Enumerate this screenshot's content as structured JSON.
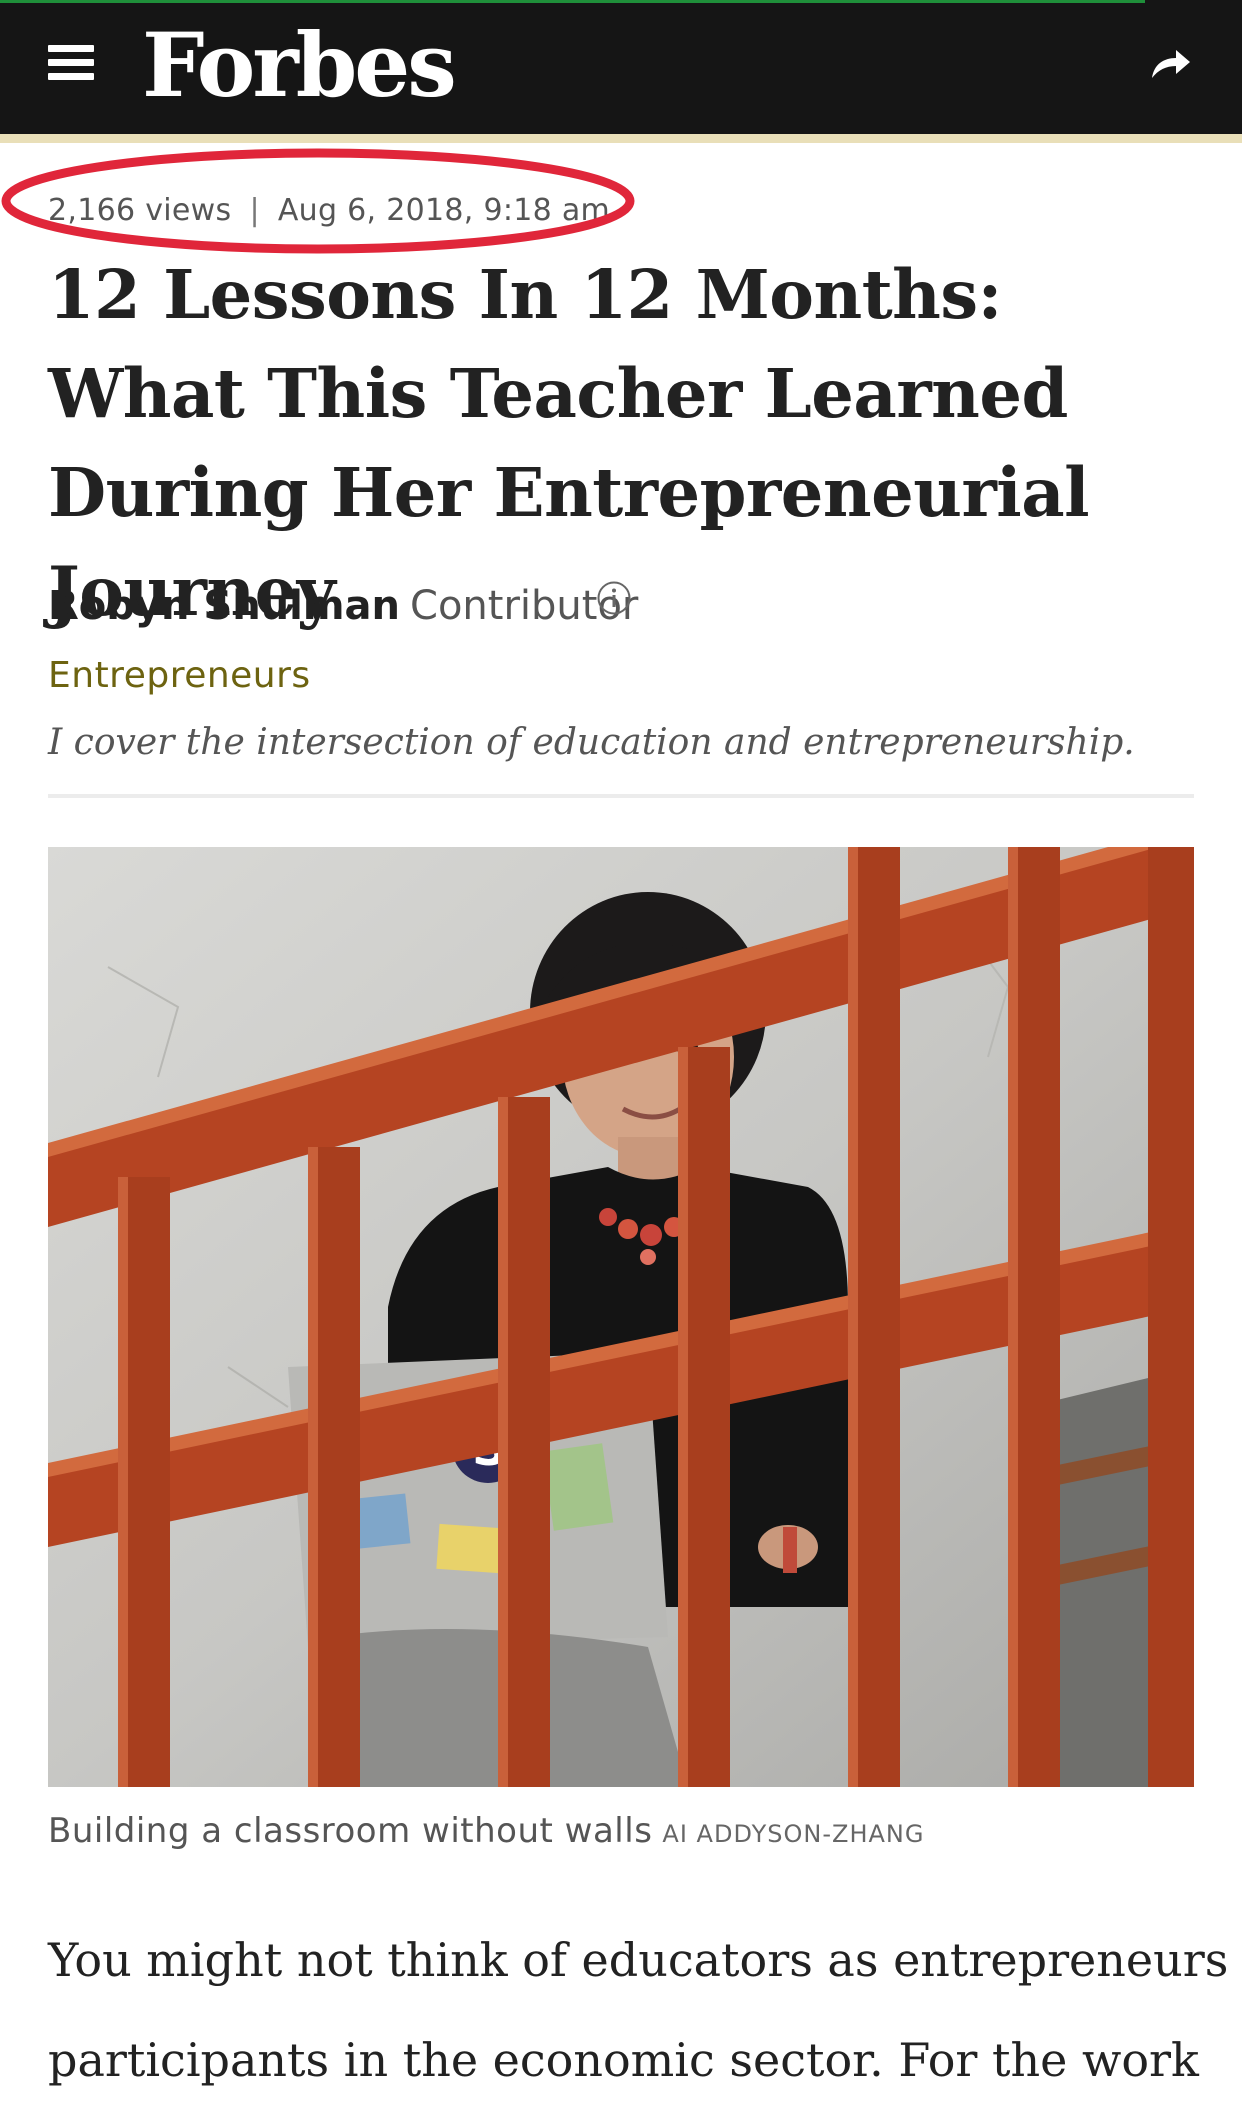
{
  "header": {
    "logo": "Forbes",
    "menu_icon": "hamburger-menu-icon",
    "share_icon": "share-arrow-icon"
  },
  "article": {
    "views": "2,166 views",
    "separator": "|",
    "date": "Aug 6, 2018, 9:18 am",
    "title": "12 Lessons In 12 Months: What This Teacher Learned During Her Entrepreneurial Journey",
    "author": "Robyn Shulman",
    "author_role": "Contributor",
    "section": "Entrepreneurs",
    "bio": "I cover the intersection of education and entrepreneurship.",
    "image_caption": "Building a classroom without walls",
    "image_credit": "AI ADDYSON-ZHANG",
    "body_first_line": "You might not think of educators as entrepreneurs or",
    "body_second_line": "participants in the economic sector. For the work"
  },
  "colors": {
    "header_bg": "#151515",
    "accent_gold": "#e9dfb8",
    "section_link": "#6d6310",
    "annotation_red": "#e0263a"
  }
}
